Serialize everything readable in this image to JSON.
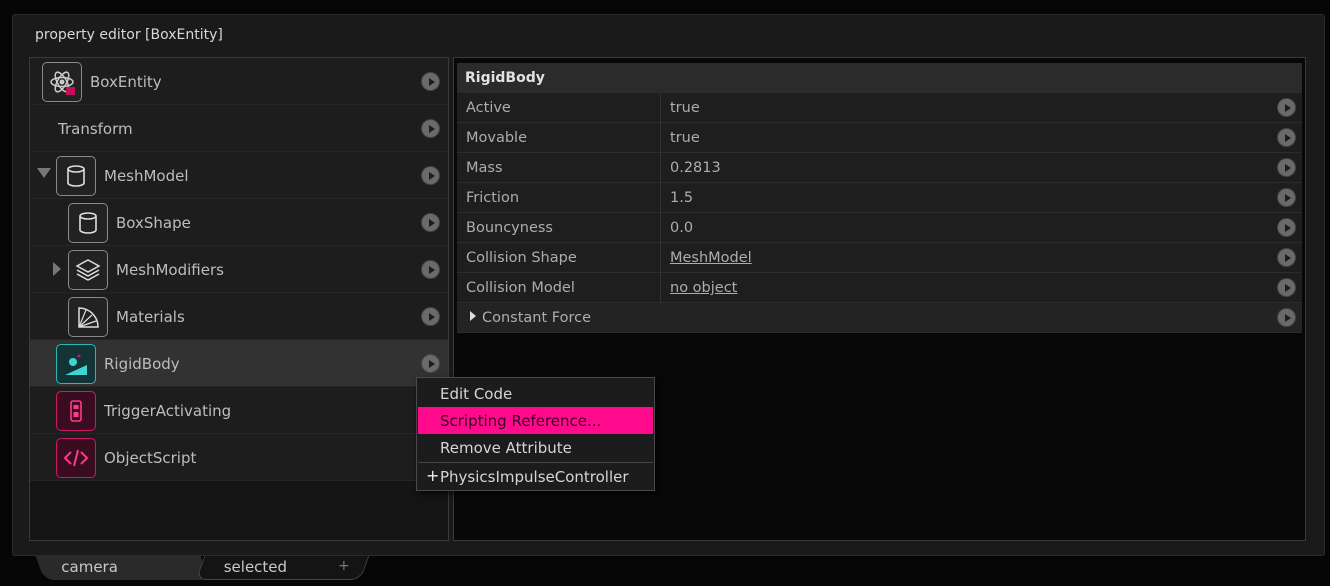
{
  "window": {
    "title": "property editor [BoxEntity]"
  },
  "tree": [
    {
      "label": "BoxEntity",
      "icon": "atom-script-icon"
    },
    {
      "label": "Transform",
      "icon": ""
    },
    {
      "label": "MeshModel",
      "icon": "cylinder-icon"
    },
    {
      "label": "BoxShape",
      "icon": "cylinder-icon"
    },
    {
      "label": "MeshModifiers",
      "icon": "layers-icon"
    },
    {
      "label": "Materials",
      "icon": "material-fan-icon"
    },
    {
      "label": "RigidBody",
      "icon": "rigidbody-icon"
    },
    {
      "label": "TriggerActivating",
      "icon": "trigger-icon"
    },
    {
      "label": "ObjectScript",
      "icon": "code-icon"
    }
  ],
  "properties": {
    "header": "RigidBody",
    "rows": [
      {
        "name": "Active",
        "value": "true"
      },
      {
        "name": "Movable",
        "value": "true"
      },
      {
        "name": "Mass",
        "value": "0.2813"
      },
      {
        "name": "Friction",
        "value": "1.5"
      },
      {
        "name": "Bouncyness",
        "value": "0.0"
      },
      {
        "name": "Collision Shape",
        "value": "MeshModel"
      },
      {
        "name": "Collision Model",
        "value": "no object"
      }
    ],
    "group": "Constant Force"
  },
  "context_menu": {
    "items": [
      "Edit Code",
      "Scripting Reference...",
      "Remove Attribute"
    ],
    "add_item": "PhysicsImpulseController",
    "highlight_color": "#ff0a8c"
  },
  "tabs": {
    "camera": "camera",
    "selected": "selected",
    "add": "+"
  }
}
